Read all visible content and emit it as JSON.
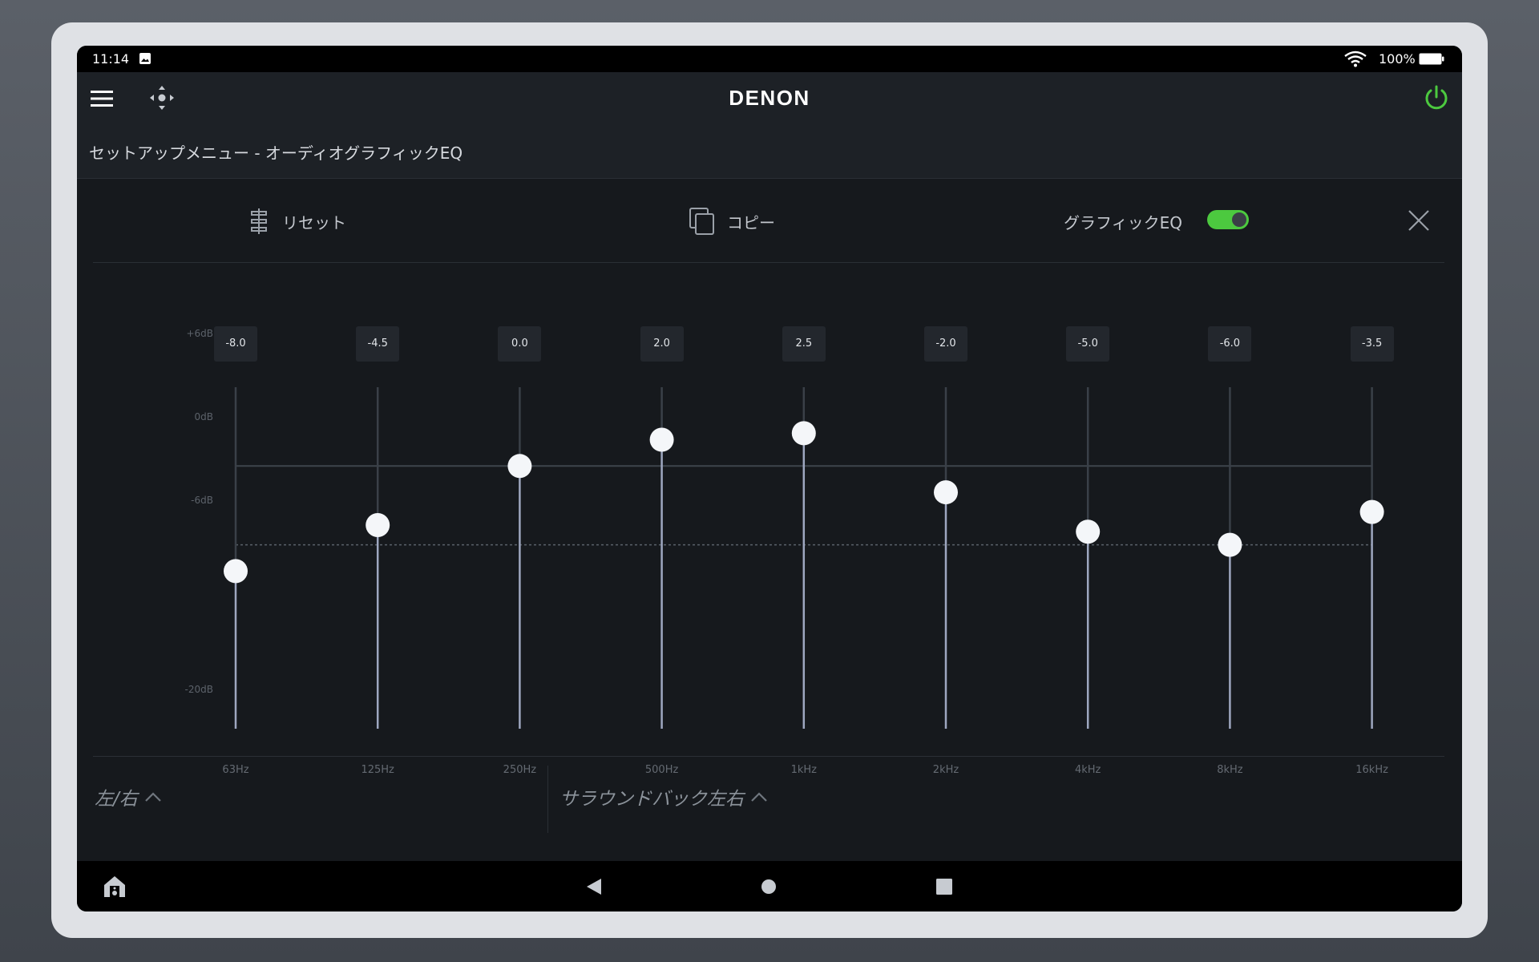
{
  "status_bar": {
    "time": "11:14",
    "battery": "100%",
    "icons": [
      "gallery-icon",
      "wifi-icon",
      "battery-icon"
    ]
  },
  "app_bar": {
    "brand": "DENON",
    "icons": [
      "hamburger-menu-icon",
      "move-arrows-icon",
      "power-icon"
    ],
    "power_color": "#4cc93f"
  },
  "breadcrumb": "セットアップメニュー - オーディオグラフィックEQ",
  "toolbar": {
    "reset_label": "リセット",
    "copy_label": "コピー",
    "geq_label": "グラフィックEQ",
    "geq_enabled": true
  },
  "eq": {
    "db_labels": [
      "+6dB",
      "0dB",
      "-6dB",
      "-20dB"
    ],
    "range_db": [
      -20,
      6
    ],
    "bands": [
      {
        "freq": "63Hz",
        "value": "-8.0",
        "db": -8.0
      },
      {
        "freq": "125Hz",
        "value": "-4.5",
        "db": -4.5
      },
      {
        "freq": "250Hz",
        "value": "0.0",
        "db": 0.0
      },
      {
        "freq": "500Hz",
        "value": "2.0",
        "db": 2.0
      },
      {
        "freq": "1kHz",
        "value": "2.5",
        "db": 2.5
      },
      {
        "freq": "2kHz",
        "value": "-2.0",
        "db": -2.0
      },
      {
        "freq": "4kHz",
        "value": "-5.0",
        "db": -5.0
      },
      {
        "freq": "8kHz",
        "value": "-6.0",
        "db": -6.0
      },
      {
        "freq": "16kHz",
        "value": "-3.5",
        "db": -3.5
      }
    ]
  },
  "channels": {
    "left_right": "左/右",
    "surround_back": "サラウンドバック左右"
  },
  "colors": {
    "accent_green": "#4cc93f",
    "panel": "#16191d"
  }
}
